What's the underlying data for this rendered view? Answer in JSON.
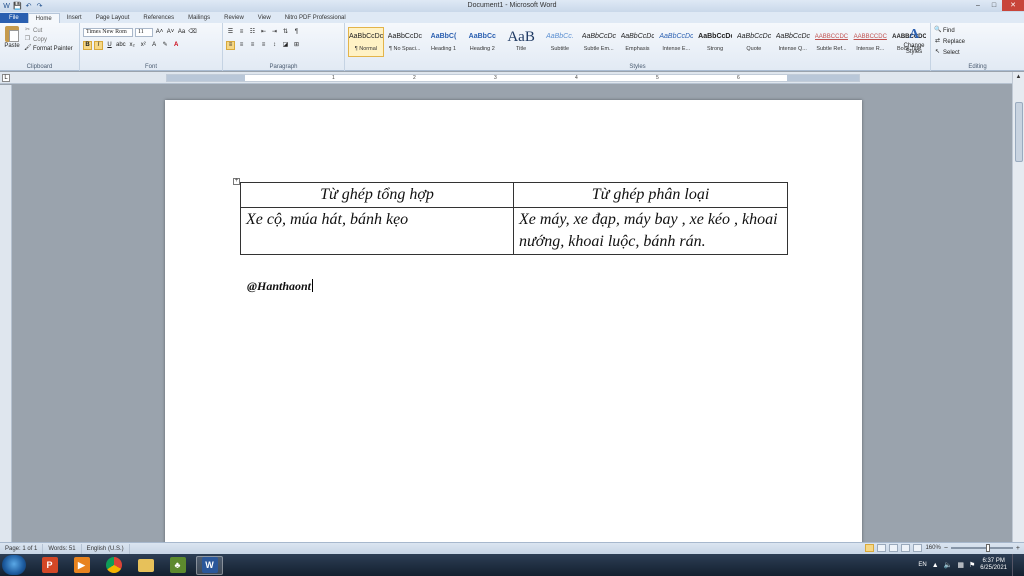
{
  "window": {
    "title": "Document1 - Microsoft Word",
    "minimize": "–",
    "maximize": "□",
    "close": "✕"
  },
  "quick_access": [
    "W",
    "💾",
    "↶",
    "↷"
  ],
  "tabs": [
    {
      "label": "File"
    },
    {
      "label": "Home"
    },
    {
      "label": "Insert"
    },
    {
      "label": "Page Layout"
    },
    {
      "label": "References"
    },
    {
      "label": "Mailings"
    },
    {
      "label": "Review"
    },
    {
      "label": "View"
    },
    {
      "label": "Nitro PDF Professional"
    }
  ],
  "clipboard": {
    "paste": "Paste",
    "cut": "Cut",
    "copy": "Copy",
    "format_painter": "Format Painter",
    "label": "Clipboard"
  },
  "font": {
    "name": "Times New Rom",
    "size": "11",
    "grow": "A˄",
    "shrink": "A˅",
    "case": "Aa",
    "bold": "B",
    "italic": "I",
    "underline": "U",
    "strike": "abc",
    "subscript": "x₂",
    "superscript": "x²",
    "label": "Font"
  },
  "paragraph": {
    "label": "Paragraph"
  },
  "styles": {
    "label": "Styles",
    "items": [
      {
        "preview": "AaBbCcDc",
        "name": "¶ Normal",
        "selected": true
      },
      {
        "preview": "AaBbCcDc",
        "name": "¶ No Spaci..."
      },
      {
        "preview": "AaBbC(",
        "name": "Heading 1"
      },
      {
        "preview": "AaBbCc",
        "name": "Heading 2"
      },
      {
        "preview": "AaB",
        "name": "Title"
      },
      {
        "preview": "AaBbCc.",
        "name": "Subtitle"
      },
      {
        "preview": "AaBbCcDc",
        "name": "Subtle Em..."
      },
      {
        "preview": "AaBbCcDc",
        "name": "Emphasis"
      },
      {
        "preview": "AaBbCcDc",
        "name": "Intense E..."
      },
      {
        "preview": "AaBbCcDc",
        "name": "Strong"
      },
      {
        "preview": "AaBbCcDc",
        "name": "Quote"
      },
      {
        "preview": "AaBbCcDc",
        "name": "Intense Q..."
      },
      {
        "preview": "AABBCCDC",
        "name": "Subtle Ref..."
      },
      {
        "preview": "AABBCCDC",
        "name": "Intense R..."
      },
      {
        "preview": "AABBCCDC",
        "name": "Book Title"
      }
    ],
    "change_styles": "Change Styles"
  },
  "editing": {
    "find": "Find",
    "replace": "Replace",
    "select": "Select",
    "label": "Editing"
  },
  "ruler": {
    "tab_selector": "L",
    "numbers": [
      "1",
      "2",
      "3",
      "4",
      "5",
      "6"
    ]
  },
  "document": {
    "table_anchor": "+",
    "table": {
      "headers": [
        "Từ ghép tổng hợp",
        "Từ ghép phân loại"
      ],
      "rows": [
        [
          "Xe cộ, múa hát, bánh kẹo",
          "Xe máy, xe đạp, máy bay , xe kéo , khoai nướng, khoai luộc, bánh rán."
        ]
      ]
    },
    "signature": "@Hanthaont"
  },
  "status": {
    "page": "Page: 1 of 1",
    "words": "Words: 51",
    "language": "English (U.S.)",
    "zoom": "160%",
    "zoom_minus": "−",
    "zoom_plus": "+",
    "zoom_level": 0.6
  },
  "taskbar": {
    "apps": [
      {
        "name": "powerpoint",
        "glyph": "P"
      },
      {
        "name": "media-player",
        "glyph": "▶"
      },
      {
        "name": "chrome",
        "glyph": ""
      },
      {
        "name": "file-explorer",
        "glyph": ""
      },
      {
        "name": "game",
        "glyph": "♣"
      },
      {
        "name": "word",
        "glyph": "W"
      }
    ],
    "language": "EN",
    "time": "6:37 PM",
    "date": "6/25/2021"
  },
  "colors": {
    "file_tab": "#2a5fb0",
    "selected_style": "#fff2c5",
    "taskbar": "#13202f"
  }
}
